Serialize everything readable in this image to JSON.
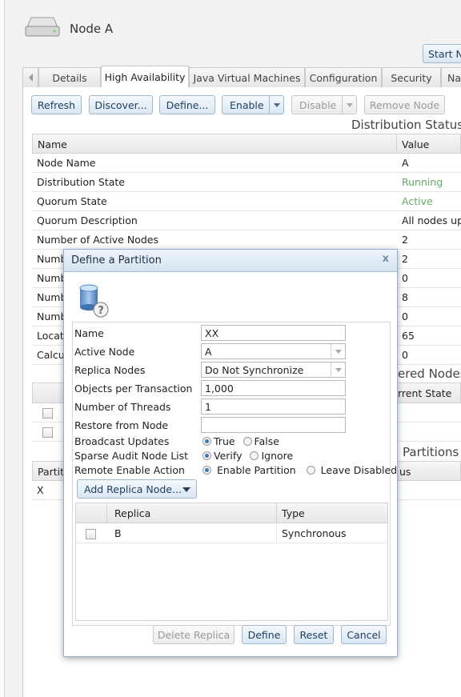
{
  "header": {
    "title": "Node A",
    "start_button": "Start N"
  },
  "tabs": [
    "Details",
    "High Availability",
    "Java Virtual Machines",
    "Configuration",
    "Security",
    "Na"
  ],
  "toolbar": {
    "refresh": "Refresh",
    "discover": "Discover...",
    "define": "Define...",
    "enable": "Enable",
    "disable": "Disable",
    "remove_node": "Remove Node"
  },
  "distribution_status": {
    "heading": "Distribution Status",
    "columns": [
      "Name",
      "Value"
    ],
    "rows": [
      [
        "Node Name",
        "A"
      ],
      [
        "Distribution State",
        "Running"
      ],
      [
        "Quorum State",
        "Active"
      ],
      [
        "Quorum Description",
        "All nodes up"
      ],
      [
        "Number of Active Nodes",
        "2"
      ],
      [
        "Numb",
        "2"
      ],
      [
        "Numb",
        "0"
      ],
      [
        "Numb",
        "8"
      ],
      [
        "Numb",
        "0"
      ],
      [
        "Locat",
        "65"
      ],
      [
        "Calcul",
        "0"
      ]
    ],
    "status_colors": {
      "running": "#5fae5f",
      "active": "#5fae5f"
    }
  },
  "discovered_nodes": {
    "heading": "ered Nodes",
    "column": "rrent State"
  },
  "partitions": {
    "heading": "Partitions",
    "col1": "Partit",
    "col2": "us",
    "row1": "X"
  },
  "dialog": {
    "title": "Define a Partition",
    "close": "x",
    "icon": "database-help-icon",
    "fields": {
      "name_label": "Name",
      "name_value": "XX",
      "active_node_label": "Active Node",
      "active_node_value": "A",
      "replica_nodes_label": "Replica Nodes",
      "replica_nodes_value": "Do Not Synchronize",
      "objects_label": "Objects per Transaction",
      "objects_value": "1,000",
      "threads_label": "Number of Threads",
      "threads_value": "1",
      "restore_label": "Restore from Node",
      "restore_value": "",
      "broadcast_label": "Broadcast Updates",
      "broadcast_true": "True",
      "broadcast_false": "False",
      "sparse_label": "Sparse Audit Node List",
      "sparse_verify": "Verify",
      "sparse_ignore": "Ignore",
      "remote_label": "Remote Enable Action",
      "remote_enable": "Enable Partition",
      "remote_leave": "Leave Disabled"
    },
    "add_replica": "Add Replica Node...",
    "table": {
      "columns": [
        "Replica",
        "Type"
      ],
      "rows": [
        {
          "replica": "B",
          "type": "Synchronous"
        }
      ]
    },
    "buttons": {
      "delete": "Delete Replica",
      "define": "Define",
      "reset": "Reset",
      "cancel": "Cancel"
    }
  }
}
